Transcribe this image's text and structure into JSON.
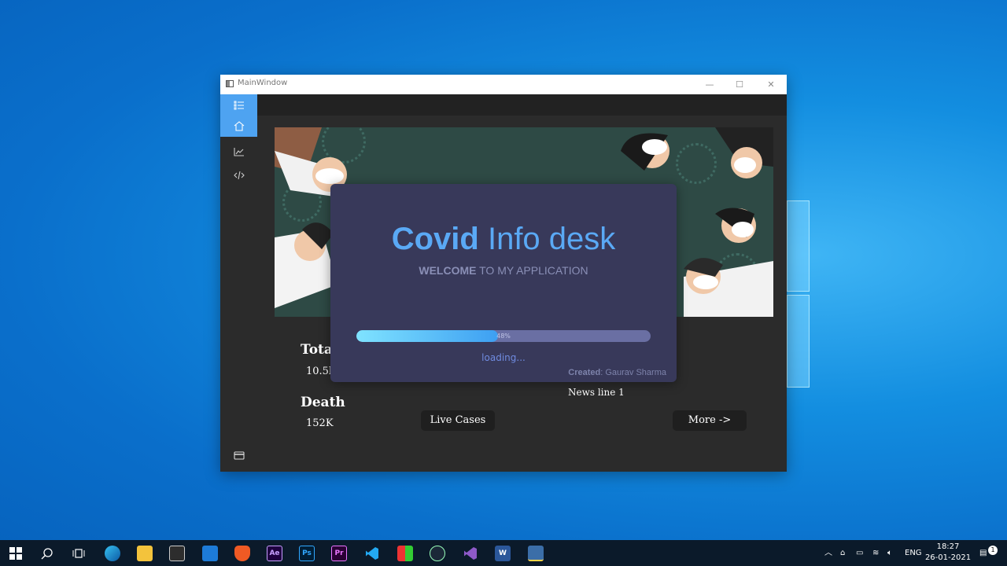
{
  "window": {
    "title": "MainWindow",
    "min": "—",
    "max": "☐",
    "close": "✕"
  },
  "sidebar": {
    "icons": [
      "menu-icon",
      "home-icon",
      "chart-icon",
      "code-icon",
      "card-icon"
    ]
  },
  "stats": {
    "total_label": "Tota",
    "total_value": "10.5l",
    "death_label": "Death",
    "death_value": "152K"
  },
  "news": {
    "line": "News line 1"
  },
  "buttons": {
    "live_cases": "Live Cases",
    "more": "More ->"
  },
  "splash": {
    "title_bold": "Covid",
    "title_rest": " Info desk",
    "subtitle_bold": "WELCOME",
    "subtitle_rest": " TO MY APPLICATION",
    "progress_percent": 48,
    "progress_label": "48%",
    "loading": "loading...",
    "credit_label": "Created",
    "credit_name": ": Gaurav Sharma"
  },
  "taskbar": {
    "apps": [
      "start",
      "search",
      "task-view",
      "edge",
      "file-explorer",
      "store",
      "mail",
      "brave",
      "after-effects",
      "photoshop",
      "premiere",
      "vscode",
      "app-grid",
      "steam",
      "visual-studio",
      "word",
      "python"
    ],
    "ae": "Ae",
    "ps": "Ps",
    "pr": "Pr",
    "w": "W",
    "language": "ENG",
    "time": "18:27",
    "date": "26-01-2021",
    "notification_count": "1"
  },
  "colors": {
    "accent": "#4ea3f1",
    "splash_bg": "#38395a",
    "title_blue": "#5aa9f5"
  }
}
